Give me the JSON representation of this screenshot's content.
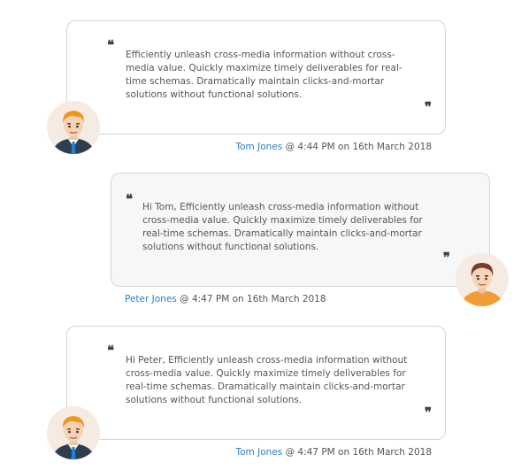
{
  "icons": {
    "quote_open": "open-quote-icon",
    "quote_close": "close-quote-icon",
    "avatar": "avatar"
  },
  "colors": {
    "link": "#2a7fc1",
    "text": "#555555",
    "border": "#d6d6d6",
    "incoming_bg": "#ffffff",
    "outgoing_bg": "#f7f7f7"
  },
  "messages": [
    {
      "text": "Efficiently unleash cross-media information without cross-media value. Quickly maximize timely deliverables for real-time schemas. Dramatically maintain clicks-and-mortar solutions without functional solutions.",
      "author": "Tom Jones",
      "timestamp": "@ 4:44 PM on 16th March 2018",
      "open_quote": "❝",
      "close_quote": "❞"
    },
    {
      "text": "Hi Tom, Efficiently unleash cross-media information without cross-media value. Quickly maximize timely deliverables for real-time schemas. Dramatically maintain clicks-and-mortar solutions without functional solutions.",
      "author": "Peter Jones",
      "timestamp": "@ 4:47 PM on 16th March 2018",
      "open_quote": "❝",
      "close_quote": "❞"
    },
    {
      "text": "Hi Peter, Efficiently unleash cross-media information without cross-media value. Quickly maximize timely deliverables for real-time schemas. Dramatically maintain clicks-and-mortar solutions without functional solutions.",
      "author": "Tom Jones",
      "timestamp": "@ 4:47 PM on 16th March 2018",
      "open_quote": "❝",
      "close_quote": "❞"
    }
  ]
}
